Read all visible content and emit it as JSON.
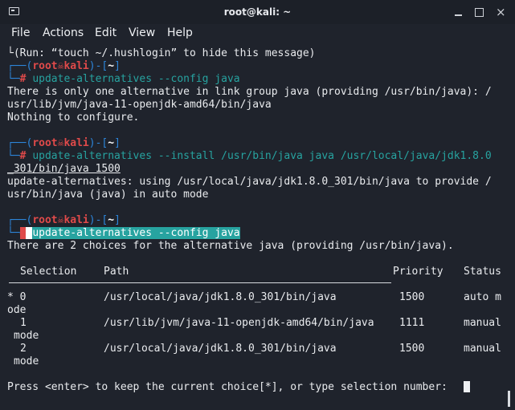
{
  "window": {
    "title": "root@kali: ~"
  },
  "menu": [
    "File",
    "Actions",
    "Edit",
    "View",
    "Help"
  ],
  "prompt": {
    "open": "┌──(",
    "user": "root",
    "host": "kali",
    "mid": ")-[",
    "dir": "~",
    "close": "]",
    "hash": "└─# "
  },
  "lines": {
    "hush": "└(Run: “touch ~/.hushlogin” to hide this message)",
    "cmd1": "update-alternatives --config java",
    "out1a": "There is only one alternative in link group java (providing /usr/bin/java): /",
    "out1b": "usr/lib/jvm/java-11-openjdk-amd64/bin/java",
    "out1c": "Nothing to configure.",
    "cmd2a": "update-alternatives --install /usr/bin/java java /usr/local/java/jdk1.8.0",
    "cmd2b": "_301/bin/java 1500",
    "out2a": "update-alternatives: using /usr/local/java/jdk1.8.0_301/bin/java to provide /",
    "out2b": "usr/bin/java (java) in auto mode",
    "cmd3": "update-alternatives --config java",
    "out3": "There are 2 choices for the alternative java (providing /usr/bin/java).",
    "prompt_final": "Press <enter> to keep the current choice[*], or type selection number: "
  },
  "table": {
    "headers": {
      "selection": "Selection",
      "path": "Path",
      "priority": "Priority",
      "status": "Status"
    },
    "rows": [
      {
        "sel": "* 0",
        "path": "/usr/local/java/jdk1.8.0_301/bin/java",
        "priority": "1500",
        "status": "auto m",
        "wrap": "ode"
      },
      {
        "sel": "1",
        "path": "/usr/lib/jvm/java-11-openjdk-amd64/bin/java",
        "priority": "1111",
        "status": "manual",
        "wrap": "mode"
      },
      {
        "sel": "2",
        "path": "/usr/local/java/jdk1.8.0_301/bin/java",
        "priority": "1500",
        "status": "manual",
        "wrap": "mode"
      }
    ]
  },
  "colors": {
    "background": "#1f232c",
    "prompt_blue": "#2d85d9",
    "user_red": "#e04a4a",
    "dir_green": "#1ea37a",
    "highlight_teal": "#27a3a0",
    "highlight_purple": "#8f3db7"
  }
}
